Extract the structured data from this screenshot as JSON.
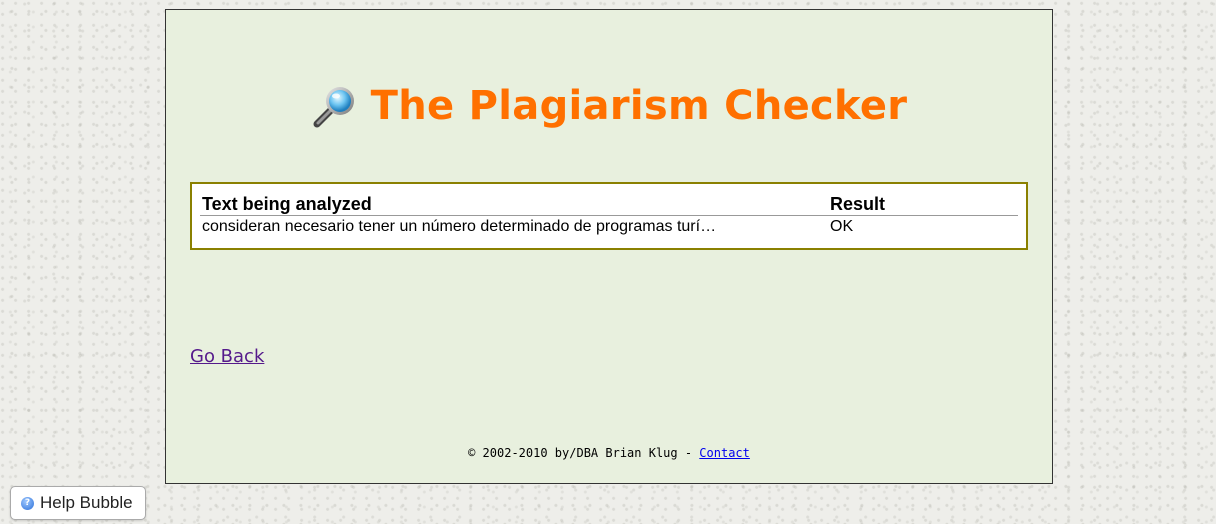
{
  "page": {
    "title": "The Plagiarism Checker",
    "title_color": "#ff7000",
    "panel_bg": "#e8f0de",
    "box_border_color": "#8a8000"
  },
  "title_icon": "magnifying-glass-icon",
  "results": {
    "headers": {
      "text": "Text being analyzed",
      "result": "Result"
    },
    "rows": [
      {
        "text": "consideran necesario tener un número determinado de programas turí…",
        "result": "OK"
      }
    ]
  },
  "go_back": "Go Back",
  "footer": {
    "copyright": "© 2002-2010 by/DBA Brian Klug - ",
    "contact": "Contact"
  },
  "help_bubble": {
    "label": "Help Bubble",
    "icon": "help-icon"
  }
}
